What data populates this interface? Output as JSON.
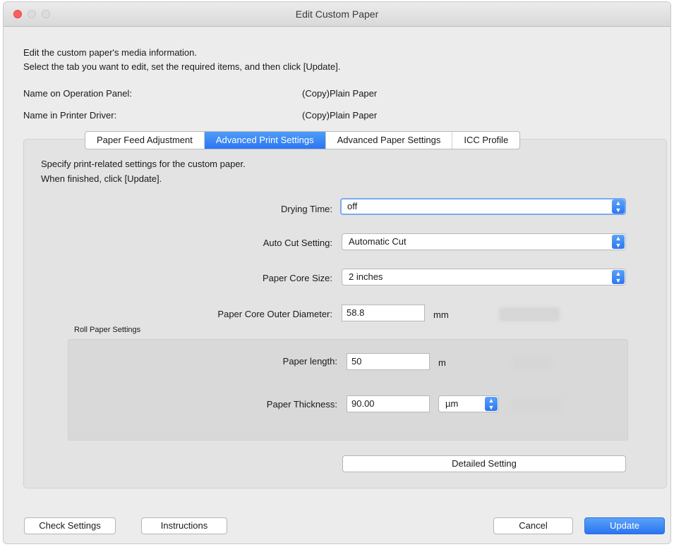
{
  "window": {
    "title": "Edit Custom Paper"
  },
  "intro": {
    "line1": "Edit the custom paper's media information.",
    "line2": "Select the tab you want to edit, set the required items, and then click [Update]."
  },
  "names": {
    "operation_panel_label": "Name on Operation Panel:",
    "operation_panel_value": "(Copy)Plain Paper",
    "printer_driver_label": "Name in Printer Driver:",
    "printer_driver_value": "(Copy)Plain Paper"
  },
  "tabs": [
    {
      "label": "Paper Feed Adjustment",
      "active": false
    },
    {
      "label": "Advanced Print Settings",
      "active": true
    },
    {
      "label": "Advanced Paper Settings",
      "active": false
    },
    {
      "label": "ICC Profile",
      "active": false
    }
  ],
  "panel": {
    "desc1": "Specify print-related settings for the custom paper.",
    "desc2": "When finished, click [Update].",
    "drying_time": {
      "label": "Drying Time:",
      "value": "off"
    },
    "auto_cut": {
      "label": "Auto Cut Setting:",
      "value": "Automatic Cut"
    },
    "core_size": {
      "label": "Paper Core Size:",
      "value": "2 inches"
    },
    "core_diameter": {
      "label": "Paper Core Outer Diameter:",
      "value": "58.8",
      "unit": "mm"
    },
    "roll_group": {
      "title": "Roll Paper Settings",
      "length": {
        "label": "Paper length:",
        "value": "50",
        "unit": "m"
      },
      "thickness": {
        "label": "Paper Thickness:",
        "value": "90.00",
        "unit": "µm"
      }
    },
    "detailed_button": "Detailed Setting"
  },
  "footer": {
    "check_settings": "Check Settings",
    "instructions": "Instructions",
    "cancel": "Cancel",
    "update": "Update"
  },
  "colors": {
    "accent": "#2b76f2",
    "close": "#fc605c"
  }
}
